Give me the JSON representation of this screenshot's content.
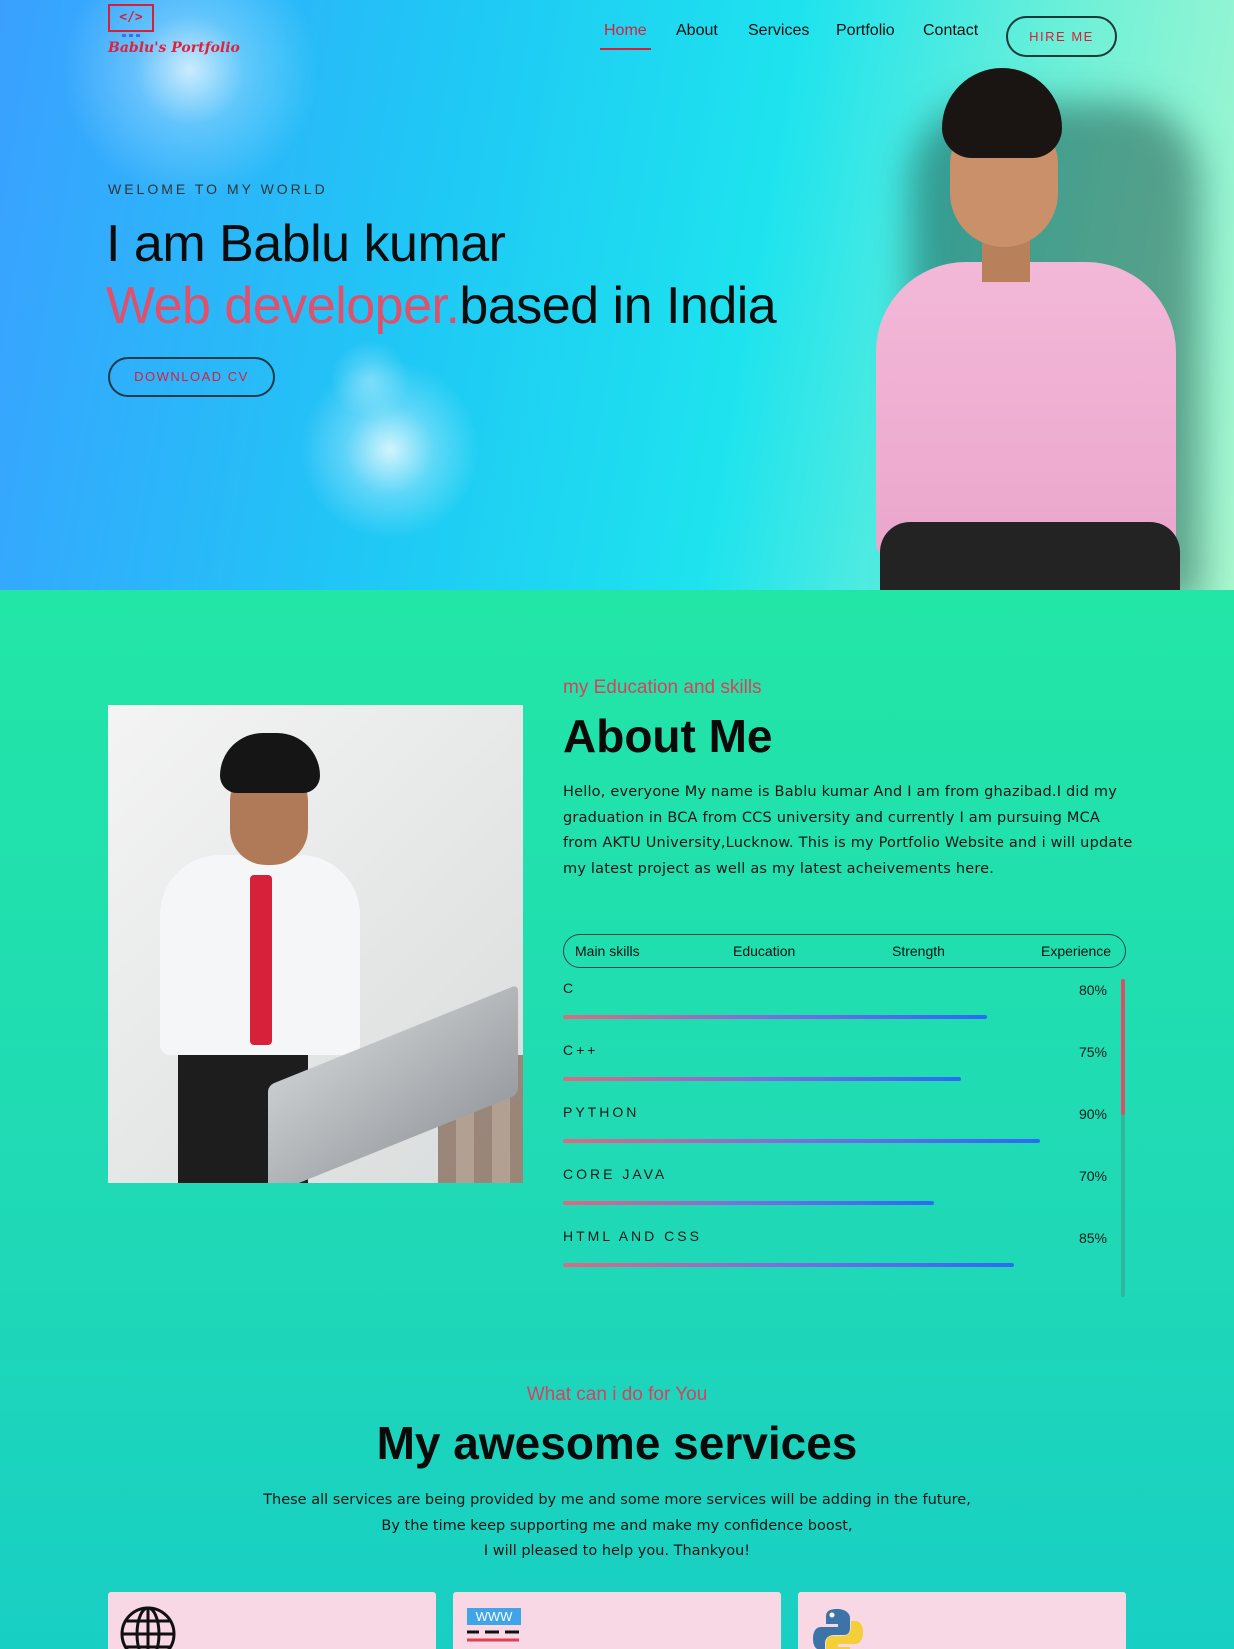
{
  "logo": {
    "symbol": "</>",
    "text": "Bablu's Portfolio"
  },
  "nav": {
    "items": [
      {
        "label": "Home",
        "active": true
      },
      {
        "label": "About",
        "active": false
      },
      {
        "label": "Services",
        "active": false
      },
      {
        "label": "Portfolio",
        "active": false
      },
      {
        "label": "Contact",
        "active": false
      }
    ],
    "hire_label": "HIRE ME"
  },
  "hero": {
    "welcome": "WELOME TO MY WORLD",
    "line1": "I am Bablu kumar",
    "line2_accent": "Web developer.",
    "line2_rest": "based in India",
    "download_label": "DOWNLOAD CV"
  },
  "about": {
    "subtitle": "my Education and skills",
    "title": "About Me",
    "text": "Hello, everyone My name is Bablu kumar And I am from ghazibad.I did my graduation in BCA from CCS university and currently I am pursuing MCA from AKTU University,Lucknow. This is my Portfolio Website and i will update my latest project as well as my latest acheivements here.",
    "tabs": [
      "Main skills",
      "Education",
      "Strength",
      "Experience"
    ],
    "skills": [
      {
        "name": "C",
        "percent_label": "80%",
        "percent": 80
      },
      {
        "name": "C++",
        "percent_label": "75%",
        "percent": 75
      },
      {
        "name": "PYTHON",
        "percent_label": "90%",
        "percent": 90
      },
      {
        "name": "CORE JAVA",
        "percent_label": "70%",
        "percent": 70
      },
      {
        "name": "HTML AND CSS",
        "percent_label": "85%",
        "percent": 85
      }
    ]
  },
  "services": {
    "subtitle": "What can i do for You",
    "title": "My awesome services",
    "text_lines": [
      "These all services are being provided by me and some more services will be adding in the future,",
      "By the time keep supporting me and make my confidence boost,",
      "I will pleased to help you. Thankyou!"
    ],
    "cards": [
      {
        "icon": "globe-icon"
      },
      {
        "icon": "www-icon",
        "icon_text": "WWW"
      },
      {
        "icon": "python-icon"
      }
    ]
  },
  "colors": {
    "accent": "#d81f3a",
    "accent_soft": "#e0506a",
    "card_bg": "#f8d8e4"
  }
}
